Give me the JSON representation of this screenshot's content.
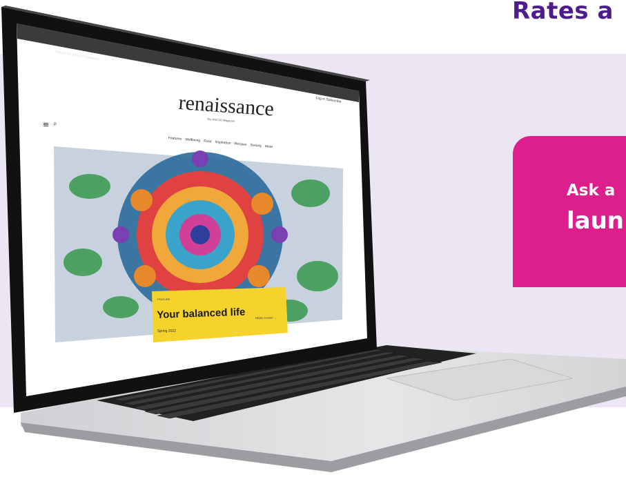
{
  "advert": {
    "headline": "Rates a",
    "cta_line1": "Ask a",
    "cta_line2": "laun",
    "colors": {
      "headline": "#4d1d8c",
      "cta_bg": "#dc1f8c",
      "band_bg": "#ece6f4"
    }
  },
  "site": {
    "topbar_text": "Search the RSCSO Magazine",
    "logo": "renaissance",
    "logo_sub": "The RSCSO Magazine",
    "signin": "Log in   Subscribe",
    "nav": [
      "Features",
      "Wellbeing",
      "Food",
      "Inspiration",
      "Recipes",
      "Society",
      "More"
    ],
    "icons": {
      "menu": "hamburger-menu-icon",
      "search": "search-icon"
    }
  },
  "feature": {
    "eyebrow": "FEATURE",
    "title": "Your balanced life",
    "date": "Spring 2022",
    "read_more": "READ STORY →"
  }
}
